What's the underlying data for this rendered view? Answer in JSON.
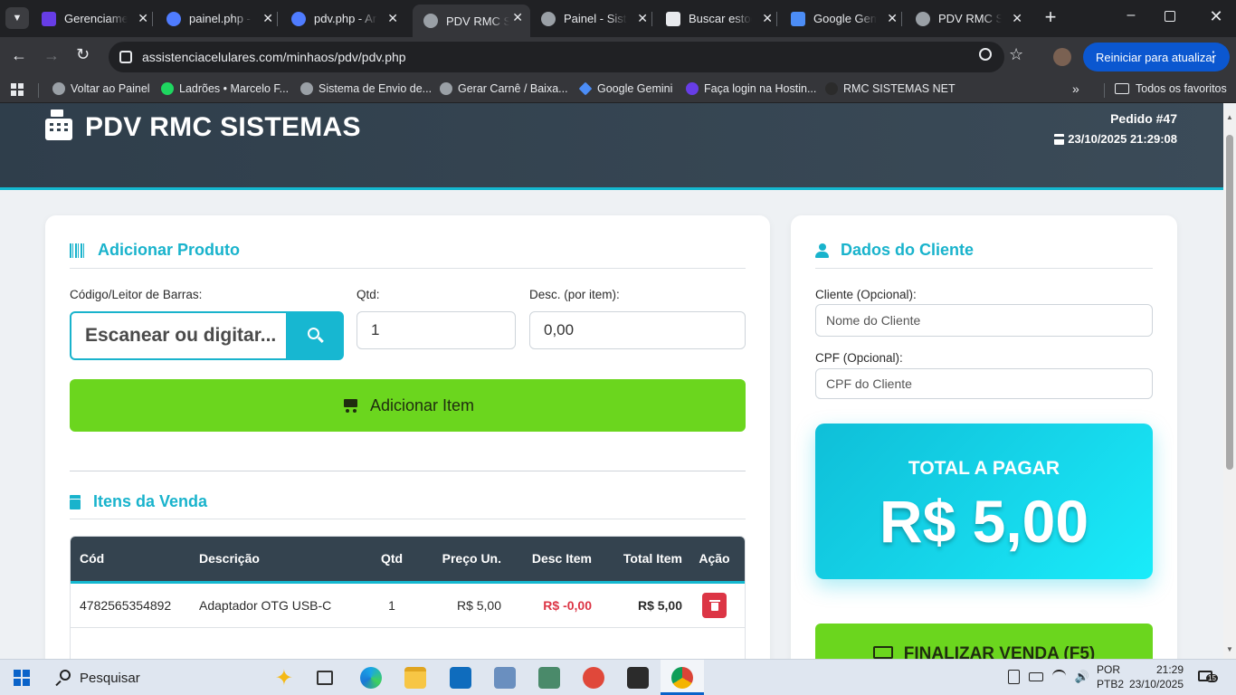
{
  "browser": {
    "tabs": [
      {
        "title": "Gerenciamento",
        "icon": "hostinger-icon",
        "color": "#673de6"
      },
      {
        "title": "painel.php - Ar",
        "icon": "globe-icon",
        "color": "#4f7cff"
      },
      {
        "title": "pdv.php - Ar",
        "icon": "globe-icon",
        "color": "#4f7cff"
      },
      {
        "title": "PDV RMC Sis",
        "icon": "globe-icon",
        "color": "#9aa0a6"
      },
      {
        "title": "Painel - Siste",
        "icon": "globe-icon",
        "color": "#9aa0a6"
      },
      {
        "title": "Buscar estoq",
        "icon": "chatgpt-icon",
        "color": "#e8eaed"
      },
      {
        "title": "Google Gem",
        "icon": "gemini-icon",
        "color": "#4c8df6"
      },
      {
        "title": "PDV RMC Sis",
        "icon": "globe-icon",
        "color": "#9aa0a6"
      }
    ],
    "url": "assistenciacelulares.com/minhaos/pdv/pdv.php",
    "update_button": "Reiniciar para atualizar",
    "bookmarks": [
      {
        "label": "Voltar ao Painel",
        "color": "#9aa0a6"
      },
      {
        "label": "Ladrões • Marcelo F...",
        "color": "#1ed760"
      },
      {
        "label": "Sistema de Envio de...",
        "color": "#9aa0a6"
      },
      {
        "label": "Gerar Carnê / Baixa...",
        "color": "#9aa0a6"
      },
      {
        "label": "Google Gemini",
        "color": "#4c8df6"
      },
      {
        "label": "Faça login na Hostin...",
        "color": "#673de6"
      },
      {
        "label": "RMC SISTEMAS NET",
        "color": "#2b2b2b"
      }
    ],
    "all_favorites": "Todos os favoritos"
  },
  "header": {
    "title": "PDV RMC SISTEMAS",
    "order": "Pedido #47",
    "datetime": "23/10/2025 21:29:08"
  },
  "add_product": {
    "title": "Adicionar Produto",
    "barcode_label": "Código/Leitor de Barras:",
    "barcode_placeholder": "Escanear ou digitar...",
    "qty_label": "Qtd:",
    "qty_value": "1",
    "discount_label": "Desc. (por item):",
    "discount_value": "0,00",
    "add_button": "Adicionar Item"
  },
  "items": {
    "title": "Itens da Venda",
    "columns": [
      "Cód",
      "Descrição",
      "Qtd",
      "Preço Un.",
      "Desc Item",
      "Total Item",
      "Ação"
    ],
    "rows": [
      {
        "code": "4782565354892",
        "description": "Adaptador OTG USB-C",
        "qty": "1",
        "unit_price": "R$ 5,00",
        "discount": "R$ -0,00",
        "total": "R$ 5,00"
      }
    ]
  },
  "customer": {
    "title": "Dados do Cliente",
    "name_label": "Cliente (Opcional):",
    "name_placeholder": "Nome do Cliente",
    "cpf_label": "CPF (Opcional):",
    "cpf_placeholder": "CPF do Cliente"
  },
  "total": {
    "label": "TOTAL A PAGAR",
    "value": "R$ 5,00"
  },
  "finalize_button": "FINALIZAR VENDA (F5)",
  "taskbar": {
    "search": "Pesquisar",
    "lang_1": "POR",
    "lang_2": "PTB2",
    "time": "21:29",
    "date": "23/10/2025",
    "notifications": "15"
  },
  "colors": {
    "accent": "#19b3cc",
    "green": "#6bd61e",
    "danger": "#dc3545",
    "header_bg": "#34434f"
  }
}
